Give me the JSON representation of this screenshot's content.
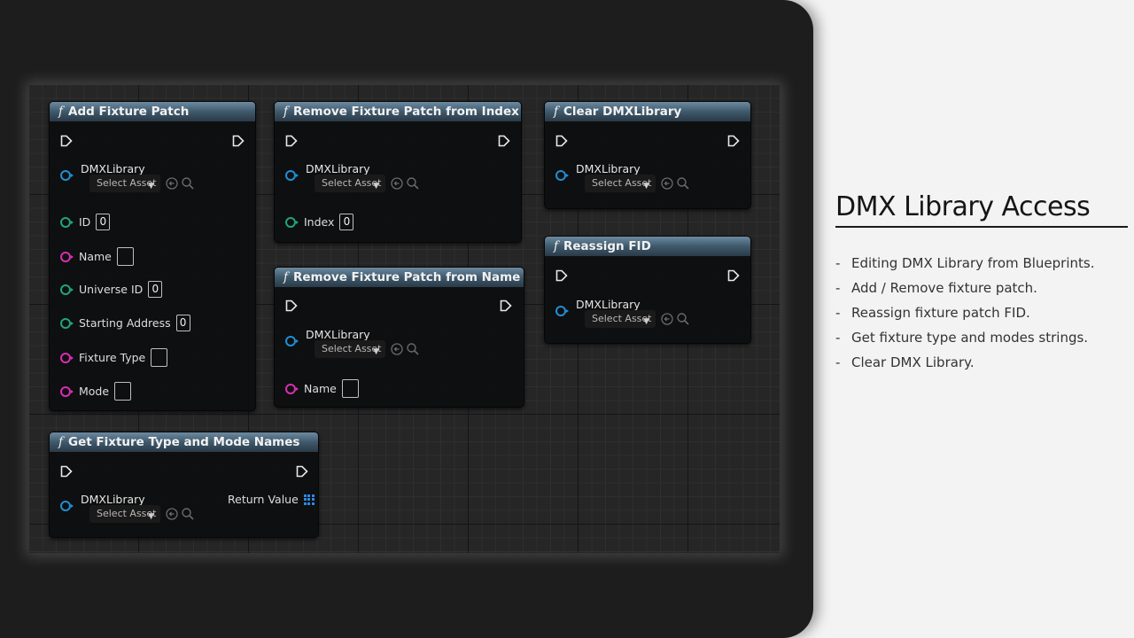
{
  "nodes": {
    "add": {
      "title": "Add Fixture Patch",
      "library_label": "DMXLibrary",
      "select_label": "Select Asset",
      "pins": [
        {
          "label": "ID",
          "value": "0"
        },
        {
          "label": "Name",
          "value": ""
        },
        {
          "label": "Universe ID",
          "value": "0"
        },
        {
          "label": "Starting Address",
          "value": "0"
        },
        {
          "label": "Fixture Type",
          "value": ""
        },
        {
          "label": "Mode",
          "value": ""
        }
      ]
    },
    "remove_index": {
      "title": "Remove Fixture Patch from Index",
      "library_label": "DMXLibrary",
      "select_label": "Select Asset",
      "index_label": "Index",
      "index_value": "0"
    },
    "remove_name": {
      "title": "Remove Fixture Patch from Name",
      "library_label": "DMXLibrary",
      "select_label": "Select Asset",
      "name_label": "Name",
      "name_value": ""
    },
    "clear": {
      "title": "Clear DMXLibrary",
      "library_label": "DMXLibrary",
      "select_label": "Select Asset"
    },
    "reassign": {
      "title": "Reassign FID",
      "library_label": "DMXLibrary",
      "select_label": "Select Asset"
    },
    "get_names": {
      "title": "Get Fixture Type and Mode Names",
      "library_label": "DMXLibrary",
      "select_label": "Select Asset",
      "return_label": "Return Value"
    }
  },
  "slide": {
    "title": "DMX Library Access",
    "bullets": [
      "Editing DMX Library from Blueprints.",
      "Add / Remove fixture patch.",
      "Reassign fixture patch FID.",
      "Get fixture type and modes strings.",
      "Clear DMX Library."
    ]
  },
  "colors": {
    "object_pin": "#1f8fd6",
    "integer_pin": "#1ea67e",
    "string_pin": "#d92eb2",
    "node_header": "#3f596c"
  }
}
